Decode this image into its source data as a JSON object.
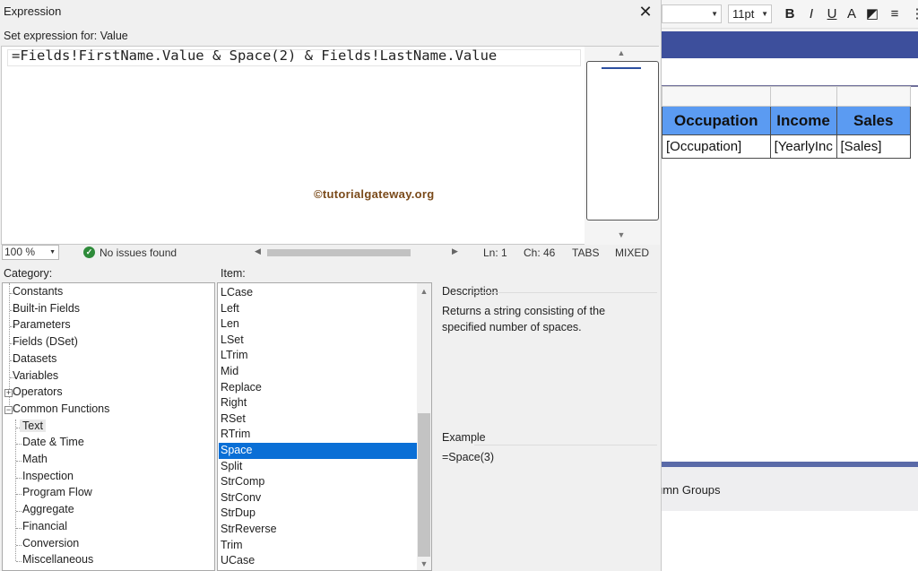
{
  "designer": {
    "font_size": "11pt",
    "toolbar_buttons": [
      {
        "name": "bold-button",
        "glyph": "B"
      },
      {
        "name": "italic-button",
        "glyph": "I"
      },
      {
        "name": "underline-button",
        "glyph": "U"
      },
      {
        "name": "font-color-button",
        "glyph": "A"
      },
      {
        "name": "background-color-button",
        "glyph": "◩"
      },
      {
        "name": "align-left-button",
        "glyph": "≡"
      },
      {
        "name": "more-options-button",
        "glyph": "⋮"
      }
    ],
    "table": {
      "headers": [
        "Occupation",
        "Income",
        "Sales"
      ],
      "cells": [
        "[Occupation]",
        "[YearlyInc",
        "[Sales]"
      ]
    },
    "groups_label": "umn Groups"
  },
  "dialog": {
    "title": "Expression",
    "close_glyph": "✕",
    "set_expression_label": "Set expression for: Value",
    "expression": "=Fields!FirstName.Value & Space(2) & Fields!LastName.Value",
    "watermark": "©tutorialgateway.org",
    "status": {
      "zoom": "100 %",
      "issues": "No issues found",
      "line": "Ln: 1",
      "char": "Ch: 46",
      "tabs": "TABS",
      "mode": "MIXED"
    },
    "category_label": "Category:",
    "item_label": "Item:",
    "categories": [
      {
        "label": "Constants",
        "level": 0
      },
      {
        "label": "Built-in Fields",
        "level": 0
      },
      {
        "label": "Parameters",
        "level": 0
      },
      {
        "label": "Fields (DSet)",
        "level": 0
      },
      {
        "label": "Datasets",
        "level": 0
      },
      {
        "label": "Variables",
        "level": 0
      },
      {
        "label": "Operators",
        "level": 0,
        "expander": "+"
      },
      {
        "label": "Common Functions",
        "level": 0,
        "expander": "−"
      },
      {
        "label": "Text",
        "level": 1,
        "selected": true
      },
      {
        "label": "Date & Time",
        "level": 1
      },
      {
        "label": "Math",
        "level": 1
      },
      {
        "label": "Inspection",
        "level": 1
      },
      {
        "label": "Program Flow",
        "level": 1
      },
      {
        "label": "Aggregate",
        "level": 1
      },
      {
        "label": "Financial",
        "level": 1
      },
      {
        "label": "Conversion",
        "level": 1
      },
      {
        "label": "Miscellaneous",
        "level": 1
      }
    ],
    "items": [
      "LCase",
      "Left",
      "Len",
      "LSet",
      "LTrim",
      "Mid",
      "Replace",
      "Right",
      "RSet",
      "RTrim",
      "Space",
      "Split",
      "StrComp",
      "StrConv",
      "StrDup",
      "StrReverse",
      "Trim",
      "UCase"
    ],
    "selected_item": "Space",
    "description_label": "Description",
    "description_text": "Returns a string consisting of the specified number of spaces.",
    "example_label": "Example",
    "example_text": "=Space(3)"
  },
  "colors": {
    "selection": "#0a6fd6",
    "header_fill": "#5b9bf2",
    "band": "#3d4f9c"
  }
}
